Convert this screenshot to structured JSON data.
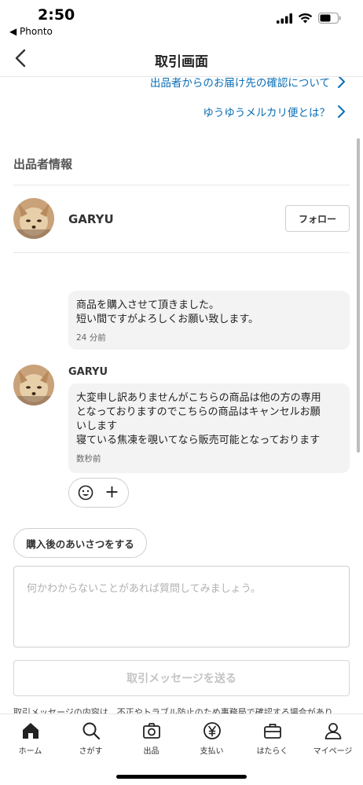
{
  "status_bar": {
    "time": "2:50",
    "back_app": "◀ Phonto"
  },
  "nav": {
    "title": "取引画面"
  },
  "links": [
    {
      "text": "出品者からのお届け先の確認について"
    },
    {
      "text": "ゆうゆうメルカリ便とは？"
    }
  ],
  "seller_section": {
    "title": "出品者情報",
    "name": "GARYU",
    "follow_label": "フォロー"
  },
  "messages": [
    {
      "sender": "",
      "lines": [
        "商品を購入させて頂きました。",
        "短い間ですがよろしくお願い致します。"
      ],
      "time": "24 分前"
    },
    {
      "sender": "GARYU",
      "lines": [
        "大変申し訳ありませんがこちらの商品は他の方の専用",
        "となっておりますのでこちらの商品はキャンセルお願",
        "いします",
        "寝ている焦凍を覗いてなら販売可能となっております"
      ],
      "time": "数秒前"
    }
  ],
  "reaction": {
    "emoji_icon": "smile-icon",
    "add_symbol": "+"
  },
  "greeting_button": "購入後のあいさつをする",
  "message_input": {
    "placeholder": "何かわからないことがあれば質問してみましょう。"
  },
  "send_button": "取引メッセージを送る",
  "footer_note": "取引メッセージの内容は、不正やトラブル防止のため事務局で確認する場合があり",
  "tabs": [
    {
      "label": "ホーム",
      "icon": "home-icon"
    },
    {
      "label": "さがす",
      "icon": "search-icon"
    },
    {
      "label": "出品",
      "icon": "camera-icon"
    },
    {
      "label": "支払い",
      "icon": "yen-icon"
    },
    {
      "label": "はたらく",
      "icon": "briefcase-icon"
    },
    {
      "label": "マイページ",
      "icon": "person-icon"
    }
  ],
  "colors": {
    "link": "#0a6eb4",
    "bubble": "#f3f3f3",
    "border": "#cfcfcf"
  }
}
